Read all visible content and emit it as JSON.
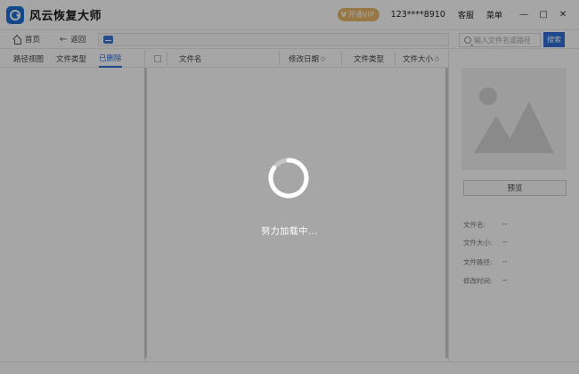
{
  "titlebar": {
    "app_title": "风云恢复大师",
    "vip_label": "开通VIP",
    "user_id": "123****8910",
    "service_label": "客服",
    "menu_label": "菜单",
    "minimize": "—",
    "maximize": "□",
    "close": "✕"
  },
  "nav": {
    "home_label": "首页",
    "back_label": "返回",
    "search_placeholder": "输入文件名或路径",
    "search_button": "搜索"
  },
  "left_tabs": [
    {
      "label": "路径视图",
      "active": false
    },
    {
      "label": "文件类型",
      "active": false
    },
    {
      "label": "已删除",
      "active": true
    }
  ],
  "table": {
    "columns": [
      "文件名",
      "修改日期",
      "文件类型",
      "文件大小"
    ]
  },
  "preview": {
    "button_label": "预览",
    "info": [
      {
        "label": "文件名:",
        "value": "--"
      },
      {
        "label": "文件大小:",
        "value": "--"
      },
      {
        "label": "文件路径:",
        "value": "--"
      },
      {
        "label": "修改时间:",
        "value": "--"
      }
    ]
  },
  "overlay": {
    "loading_text": "努力加载中..."
  },
  "colors": {
    "accent": "#2e6fd6",
    "vip": "#e8b86b",
    "overlay": "rgba(0,0,0,0.35)"
  }
}
